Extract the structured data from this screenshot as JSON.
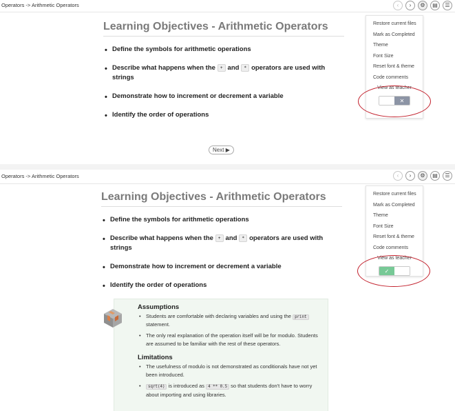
{
  "panels": [
    {
      "breadcrumb": "Operators -> Arithmetic Operators",
      "title": "Learning Objectives - Arithmetic Operators",
      "objectives": [
        "Define the symbols for arithmetic operations",
        "Describe what happens when the",
        "and",
        "operators are used with strings",
        "Demonstrate how to increment or decrement a variable",
        "Identify the order of operations"
      ],
      "chips": [
        "+",
        "*"
      ],
      "next_label": "Next",
      "menu": {
        "items": [
          "Restore current files",
          "Mark as Completed",
          "Theme",
          "Font Size",
          "Reset font & theme",
          "Code comments"
        ],
        "view_as_teacher": "View as teacher",
        "toggle_state": "off"
      }
    },
    {
      "breadcrumb": "Operators -> Arithmetic Operators",
      "title": "Learning Objectives - Arithmetic Operators",
      "objectives": [
        "Define the symbols for arithmetic operations",
        "Describe what happens when the",
        "and",
        "operators are used with strings",
        "Demonstrate how to increment or decrement a variable",
        "Identify the order of operations"
      ],
      "chips": [
        "+",
        "*"
      ],
      "menu": {
        "items": [
          "Restore current files",
          "Mark as Completed",
          "Theme",
          "Font Size",
          "Reset font & theme",
          "Code comments"
        ],
        "view_as_teacher": "View as teacher",
        "toggle_state": "on"
      },
      "teacher_box": {
        "assumptions_title": "Assumptions",
        "assumption_1a": "Students are comfortable with declaring variables and using the",
        "assumption_1_code": "print",
        "assumption_1b": "statement.",
        "assumption_2": "The only real explanation of the operation itself will be for modulo. Students are assumed to be familiar with the rest of these operators.",
        "limitations_title": "Limitations",
        "limitation_1": "The usefulness of modulo is not demonstrated as conditionals have not yet been introduced.",
        "limitation_2_code_a": "sqrt(4)",
        "limitation_2a": "is introduced as",
        "limitation_2_code_b": "4 ** 0.5",
        "limitation_2b": "so that students don't have to worry about importing and using libraries."
      }
    }
  ],
  "icons": {
    "prev": "chevron-left-icon",
    "next": "chevron-right-icon",
    "settings": "gear-icon",
    "book": "book-icon",
    "list": "list-icon",
    "next_arrow": "play-arrow-icon",
    "toggle_on": "check-icon",
    "toggle_off": "close-icon"
  },
  "colors": {
    "toggle_on": "#77c996",
    "toggle_off": "#8c94a5",
    "highlight": "#c21f2b",
    "teacher_box_bg": "#f1f7f1",
    "title_gray": "#7a7a7a"
  }
}
